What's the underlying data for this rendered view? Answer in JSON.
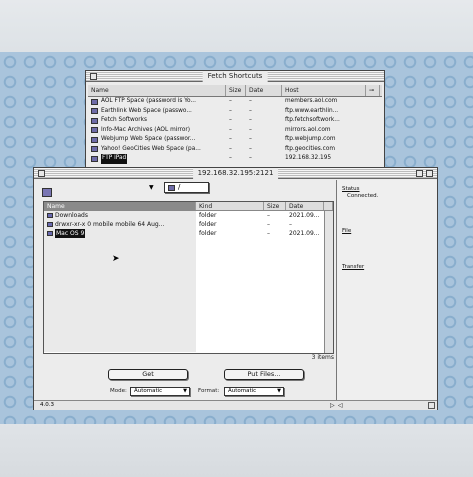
{
  "shortcuts": {
    "title": "Fetch Shortcuts",
    "headers": {
      "name": "Name",
      "size": "Size",
      "date": "Date",
      "host": "Host"
    },
    "rows": [
      {
        "name": "AOL FTP Space (password is Yo...",
        "size": "–",
        "date": "–",
        "host": "members.aol.com"
      },
      {
        "name": "Earthlink Web Space (passwo...",
        "size": "–",
        "date": "–",
        "host": "ftp.www.earthlin..."
      },
      {
        "name": "Fetch Softworks",
        "size": "–",
        "date": "–",
        "host": "ftp.fetchsoftwork..."
      },
      {
        "name": "Info-Mac Archives (AOL mirror)",
        "size": "–",
        "date": "–",
        "host": "mirrors.aol.com"
      },
      {
        "name": "Webjump Web Space (passwor...",
        "size": "–",
        "date": "–",
        "host": "ftp.webjump.com"
      },
      {
        "name": "Yahoo! GeoCities Web Space (pa...",
        "size": "–",
        "date": "–",
        "host": "ftp.geocities.com"
      },
      {
        "name": "FTP iPad",
        "size": "–",
        "date": "–",
        "host": "192.168.32.195",
        "selected": true
      }
    ]
  },
  "main": {
    "title": "192.168.32.195:2121",
    "path_popup": "/",
    "headers": {
      "name": "Name",
      "kind": "Kind",
      "size": "Size",
      "date": "Date"
    },
    "rows": [
      {
        "name": "Downloads",
        "kind": "folder",
        "size": "–",
        "date": "2021.09..."
      },
      {
        "name": "drwxr-xr-x    0 mobile mobile        64 Aug...",
        "kind": "folder",
        "size": "–",
        "date": "–"
      },
      {
        "name": "Mac OS 9",
        "kind": "folder",
        "size": "–",
        "date": "2021.09...",
        "selected": true
      }
    ],
    "items_count": "3 items",
    "get_label": "Get",
    "put_label": "Put Files...",
    "mode_label": "Mode:",
    "mode_value": "Automatic",
    "format_label": "Format:",
    "format_value": "Automatic",
    "version": "4.0.3"
  },
  "side": {
    "status_label": "Status",
    "status_value": "Connected.",
    "file_label": "File",
    "transfer_label": "Transfer"
  }
}
